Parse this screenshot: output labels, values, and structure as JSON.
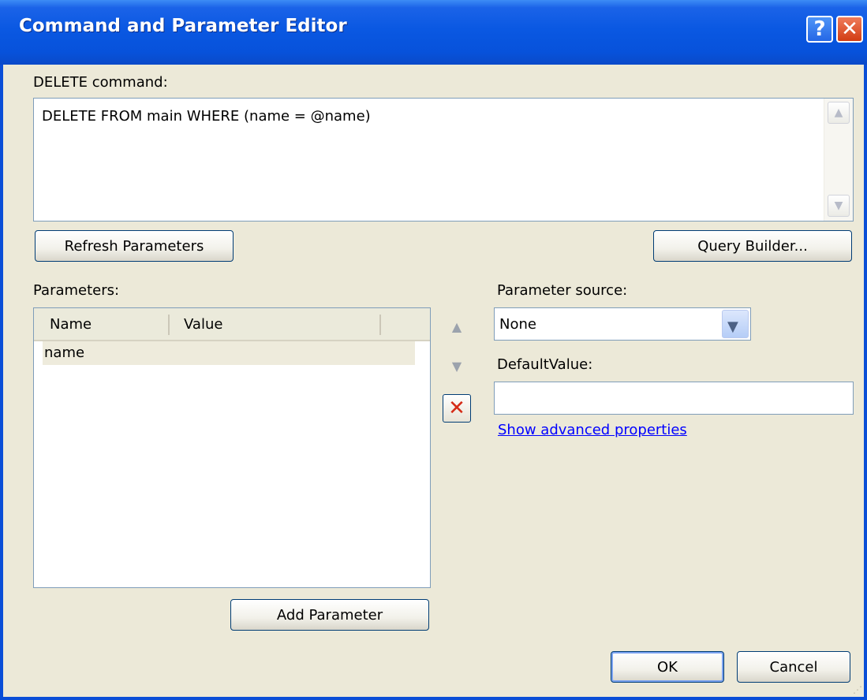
{
  "window": {
    "title": "Command and Parameter Editor"
  },
  "titlebar": {
    "help_label": "?",
    "close_label": "✕"
  },
  "command": {
    "label": "DELETE command:",
    "text": "DELETE FROM main WHERE (name = @name)"
  },
  "buttons": {
    "refresh": "Refresh Parameters",
    "query_builder": "Query Builder...",
    "add_parameter": "Add Parameter",
    "ok": "OK",
    "cancel": "Cancel"
  },
  "parameters": {
    "label": "Parameters:",
    "columns": [
      "Name",
      "Value"
    ],
    "rows": [
      {
        "name": "name",
        "value": ""
      }
    ]
  },
  "side_buttons": {
    "up_icon": "▲",
    "down_icon": "▼",
    "delete_icon": "✕"
  },
  "parameter_source": {
    "label": "Parameter source:",
    "selected": "None"
  },
  "default_value": {
    "label": "DefaultValue:",
    "value": ""
  },
  "advanced_link": "Show advanced properties"
}
